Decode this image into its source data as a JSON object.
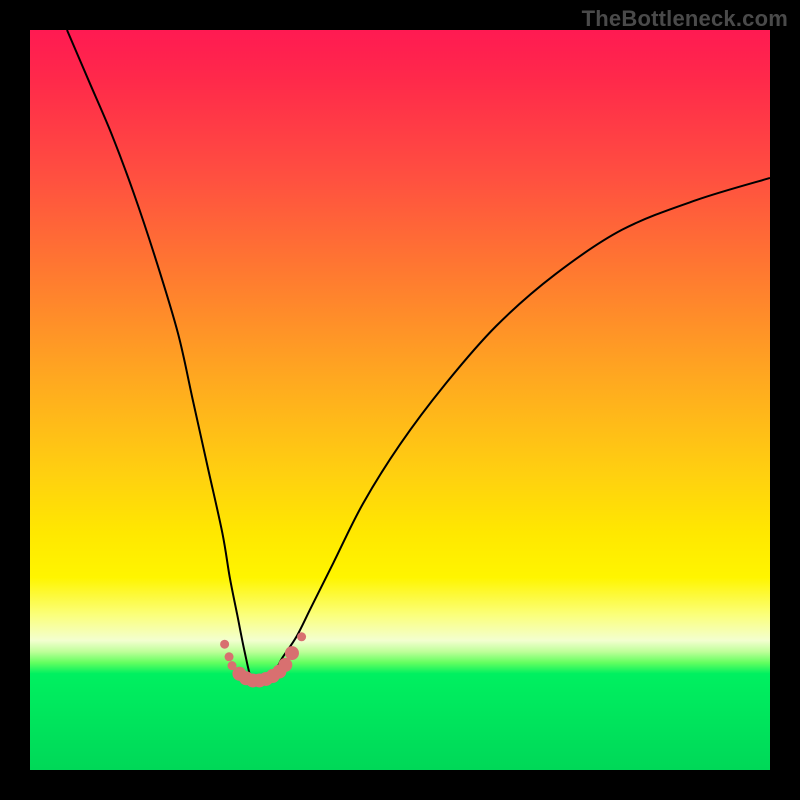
{
  "watermark": {
    "text": "TheBottleneck.com"
  },
  "chart_data": {
    "type": "line",
    "title": "",
    "xlabel": "",
    "ylabel": "",
    "xlim": [
      0,
      100
    ],
    "ylim": [
      0,
      100
    ],
    "grid": false,
    "legend": false,
    "background_gradient_stops": [
      {
        "pct": 0,
        "color": "#ff1a52"
      },
      {
        "pct": 7,
        "color": "#ff2a4a"
      },
      {
        "pct": 20,
        "color": "#ff5040"
      },
      {
        "pct": 33,
        "color": "#ff7a30"
      },
      {
        "pct": 47,
        "color": "#ffa820"
      },
      {
        "pct": 60,
        "color": "#ffd010"
      },
      {
        "pct": 68,
        "color": "#ffe800"
      },
      {
        "pct": 74,
        "color": "#fff500"
      },
      {
        "pct": 79,
        "color": "#fbff7a"
      },
      {
        "pct": 82.5,
        "color": "#f3ffd0"
      },
      {
        "pct": 84,
        "color": "#bfff9a"
      },
      {
        "pct": 85.5,
        "color": "#63ff60"
      },
      {
        "pct": 87,
        "color": "#00f060"
      },
      {
        "pct": 100,
        "color": "#00d858"
      }
    ],
    "series": [
      {
        "name": "bottleneck-curve",
        "color": "#000000",
        "x": [
          5,
          8,
          11,
          14,
          17,
          20,
          22,
          24,
          26,
          27,
          28,
          29,
          30,
          31,
          32,
          33,
          34,
          36,
          38,
          41,
          45,
          50,
          56,
          63,
          71,
          80,
          90,
          100
        ],
        "y": [
          100,
          93,
          86,
          78,
          69,
          59,
          50,
          41,
          32,
          26,
          21,
          16,
          12,
          12,
          12,
          13,
          15,
          18,
          22,
          28,
          36,
          44,
          52,
          60,
          67,
          73,
          77,
          80
        ]
      }
    ],
    "markers": {
      "name": "highlighted-points",
      "color": "#d87070",
      "radius_small": 4.5,
      "radius_large": 7,
      "points": [
        {
          "x": 26.3,
          "y": 17.0,
          "r": "small"
        },
        {
          "x": 26.9,
          "y": 15.3,
          "r": "small"
        },
        {
          "x": 27.3,
          "y": 14.1,
          "r": "small"
        },
        {
          "x": 28.3,
          "y": 13.0,
          "r": "large"
        },
        {
          "x": 29.2,
          "y": 12.4,
          "r": "large"
        },
        {
          "x": 30.1,
          "y": 12.1,
          "r": "large"
        },
        {
          "x": 31.0,
          "y": 12.1,
          "r": "large"
        },
        {
          "x": 31.9,
          "y": 12.3,
          "r": "large"
        },
        {
          "x": 32.8,
          "y": 12.7,
          "r": "large"
        },
        {
          "x": 33.7,
          "y": 13.3,
          "r": "large"
        },
        {
          "x": 34.5,
          "y": 14.2,
          "r": "large"
        },
        {
          "x": 35.4,
          "y": 15.8,
          "r": "large"
        },
        {
          "x": 36.7,
          "y": 18.0,
          "r": "small"
        }
      ]
    }
  }
}
